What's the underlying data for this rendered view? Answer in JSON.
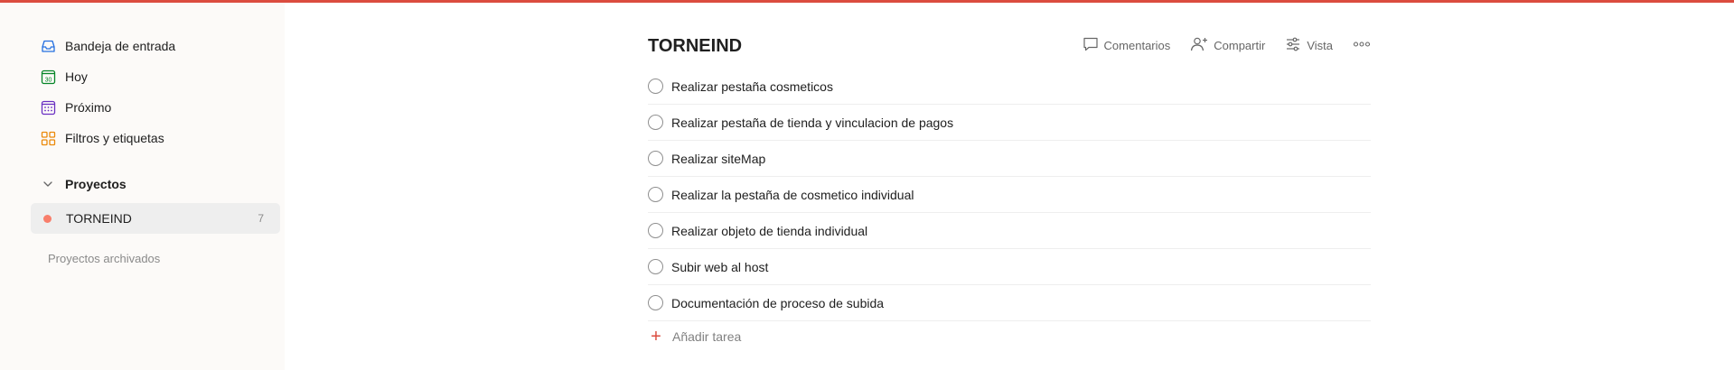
{
  "sidebar": {
    "nav": [
      {
        "label": "Bandeja de entrada",
        "icon": "inbox-icon"
      },
      {
        "label": "Hoy",
        "icon": "calendar-today-icon",
        "day": "30"
      },
      {
        "label": "Próximo",
        "icon": "calendar-upcoming-icon"
      },
      {
        "label": "Filtros y etiquetas",
        "icon": "filters-icon"
      }
    ],
    "projects_heading": "Proyectos",
    "projects": [
      {
        "name": "TORNEIND",
        "count": "7",
        "color": "#f87e6b"
      }
    ],
    "archived_label": "Proyectos archivados"
  },
  "main": {
    "title": "TORNEIND",
    "actions": {
      "comments": "Comentarios",
      "share": "Compartir",
      "view": "Vista"
    },
    "tasks": [
      "Realizar pestaña cosmeticos",
      "Realizar pestaña de tienda y vinculacion de pagos",
      "Realizar siteMap",
      "Realizar la pestaña de cosmetico individual",
      "Realizar objeto de tienda individual",
      "Subir web al host",
      "Documentación de proceso de subida"
    ],
    "add_task_label": "Añadir tarea"
  },
  "colors": {
    "accent": "#db4c3f",
    "sidebar_bg": "#fcfaf8"
  }
}
